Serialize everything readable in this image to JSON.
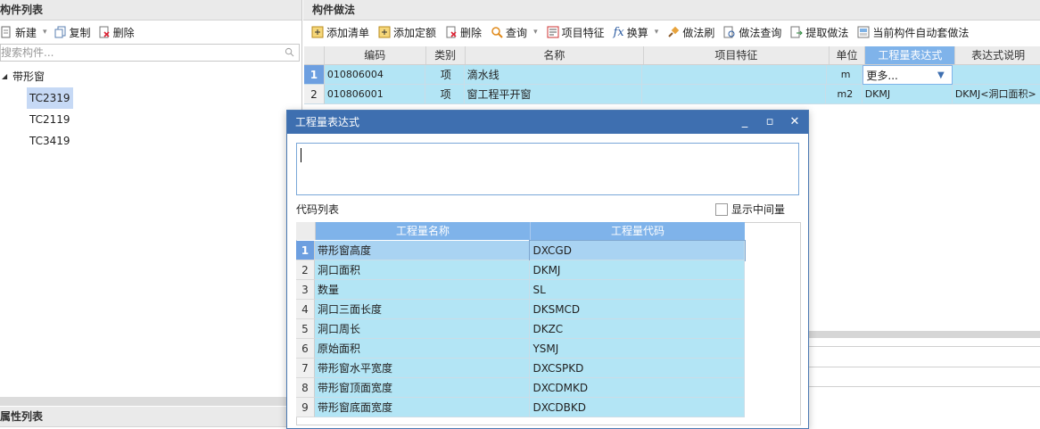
{
  "left": {
    "panel_title": "构件列表",
    "toolbar": {
      "new": "新建",
      "copy": "复制",
      "delete": "删除"
    },
    "search_placeholder": "搜索构件...",
    "tree": {
      "root": "带形窗",
      "children": [
        "TC2319",
        "TC2119",
        "TC3419"
      ]
    },
    "bottom_title": "属性列表"
  },
  "right": {
    "panel_title": "构件做法",
    "toolbar": {
      "add_list": "添加清单",
      "add_quota": "添加定额",
      "delete": "删除",
      "query": "查询",
      "item_feature": "项目特征",
      "convert": "换算",
      "method_brush": "做法刷",
      "method_query": "做法查询",
      "extract_method": "提取做法",
      "auto_apply": "当前构件自动套做法"
    },
    "grid": {
      "headers": [
        "编码",
        "类别",
        "名称",
        "项目特征",
        "单位",
        "工程量表达式",
        "表达式说明"
      ],
      "rows": [
        {
          "idx": "1",
          "code": "010806004",
          "type": "项",
          "name": "滴水线",
          "feature": "",
          "unit": "m",
          "expr": "更多...",
          "desc": ""
        },
        {
          "idx": "2",
          "code": "010806001",
          "type": "项",
          "name": "窗工程平开窗",
          "feature": "",
          "unit": "m2",
          "expr": "DKMJ",
          "desc": "DKMJ<洞口面积>"
        }
      ]
    }
  },
  "dialog": {
    "title": "工程量表达式",
    "expression_value": "",
    "code_list_label": "代码列表",
    "show_intermediate_label": "显示中间量",
    "show_intermediate_checked": false,
    "table": {
      "headers": [
        "工程量名称",
        "工程量代码"
      ],
      "rows": [
        {
          "idx": "1",
          "name": "带形窗高度",
          "code": "DXCGD"
        },
        {
          "idx": "2",
          "name": "洞口面积",
          "code": "DKMJ"
        },
        {
          "idx": "3",
          "name": "数量",
          "code": "SL"
        },
        {
          "idx": "4",
          "name": "洞口三面长度",
          "code": "DKSMCD"
        },
        {
          "idx": "5",
          "name": "洞口周长",
          "code": "DKZC"
        },
        {
          "idx": "6",
          "name": "原始面积",
          "code": "YSMJ"
        },
        {
          "idx": "7",
          "name": "带形窗水平宽度",
          "code": "DXCSPKD"
        },
        {
          "idx": "8",
          "name": "带形窗顶面宽度",
          "code": "DXCDMKD"
        },
        {
          "idx": "9",
          "name": "带形窗底面宽度",
          "code": "DXCDBKD"
        }
      ]
    }
  }
}
